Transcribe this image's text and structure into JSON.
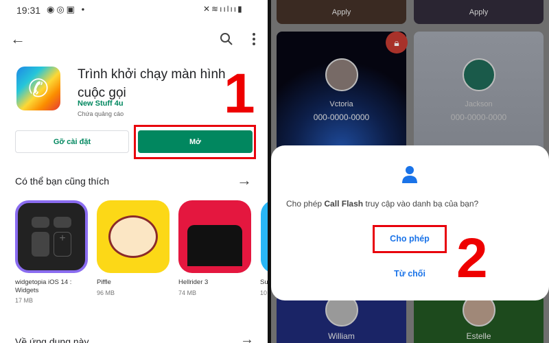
{
  "left": {
    "status": {
      "time": "19:31",
      "icons": [
        "messenger-icon",
        "sync-icon",
        "image-icon",
        "dot-icon"
      ],
      "right_icons": [
        "mute-icon",
        "wifi-icon",
        "signal-icon",
        "signal-icon",
        "battery-icon"
      ]
    },
    "toolbar": {
      "back": "back-arrow-icon",
      "search": "search-icon",
      "more": "more-vert-icon"
    },
    "app": {
      "title": "Trình khởi chạy màn hình cuộc gọi",
      "developer": "New Stuff 4u",
      "ads": "Chứa quảng cáo"
    },
    "buttons": {
      "uninstall": "Gỡ cài đặt",
      "open": "Mở"
    },
    "step": "1",
    "section": {
      "title": "Có thể bạn cũng thích",
      "items": [
        {
          "name": "widgetopia iOS 14 : Widgets",
          "size": "17 MB"
        },
        {
          "name": "Piffle",
          "size": "96 MB"
        },
        {
          "name": "Hellrider 3",
          "size": "74 MB"
        },
        {
          "name": "Su",
          "size": "10"
        }
      ]
    },
    "next_section": "Về ứng dụng này",
    "colors": {
      "green": "#01875f",
      "red": "#e8000b"
    }
  },
  "right": {
    "apply_labels": [
      "Apply",
      "Apply"
    ],
    "cards": [
      {
        "name": "Vctoria",
        "phone": "000-0000-0000"
      },
      {
        "name": "Jackson",
        "phone": "000-0000-0000"
      },
      {
        "name": "William"
      },
      {
        "name": "Estelle"
      }
    ],
    "dialog": {
      "prefix": "Cho phép ",
      "app": "Call Flash",
      "suffix": " truy cập vào danh bạ của bạn?",
      "allow": "Cho phép",
      "deny": "Từ chối",
      "icon": "person-icon"
    },
    "step": "2",
    "colors": {
      "blue": "#1a73e8"
    }
  }
}
